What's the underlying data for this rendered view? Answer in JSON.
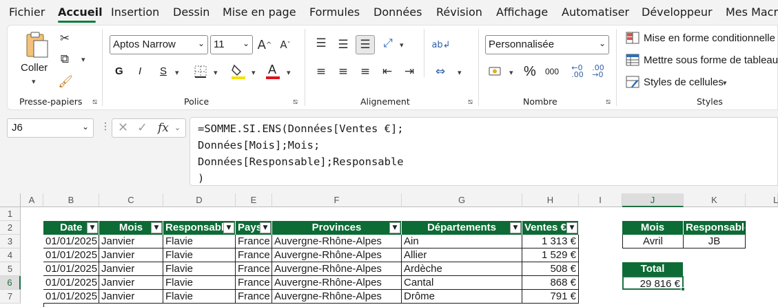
{
  "tabs": [
    "Fichier",
    "Accueil",
    "Insertion",
    "Dessin",
    "Mise en page",
    "Formules",
    "Données",
    "Révision",
    "Affichage",
    "Automatiser",
    "Développeur",
    "Mes Macro"
  ],
  "ribbon": {
    "clipboard": {
      "paste_label": "Coller",
      "group_label": "Presse-papiers"
    },
    "font": {
      "name": "Aptos Narrow",
      "size": "11",
      "bold": "G",
      "italic": "I",
      "underline": "S",
      "group_label": "Police"
    },
    "alignment": {
      "group_label": "Alignement"
    },
    "number": {
      "format": "Personnalisée",
      "percent": "%",
      "thousands": "000",
      "group_label": "Nombre"
    },
    "styles": {
      "conditional": "Mise en forme conditionnelle",
      "table": "Mettre sous forme de tableau",
      "cell_styles": "Styles de cellules",
      "group_label": "Styles"
    }
  },
  "formula_bar": {
    "name_box": "J6",
    "fx": "fx",
    "formula": "=SOMME.SI.ENS(Données[Ventes €];\nDonnées[Mois];Mois;\nDonnées[Responsable];Responsable\n)"
  },
  "columns": [
    "A",
    "B",
    "C",
    "D",
    "E",
    "F",
    "G",
    "H",
    "I",
    "J",
    "K",
    "L"
  ],
  "rows": [
    "1",
    "2",
    "3",
    "4",
    "5",
    "6",
    "7"
  ],
  "table": {
    "headers": [
      "Date",
      "Mois",
      "Responsable",
      "Pays",
      "Provinces",
      "Départements",
      "Ventes €"
    ],
    "rows": [
      [
        "01/01/2025",
        "Janvier",
        "Flavie",
        "France",
        "Auvergne-Rhône-Alpes",
        "Ain",
        "1 313 €"
      ],
      [
        "01/01/2025",
        "Janvier",
        "Flavie",
        "France",
        "Auvergne-Rhône-Alpes",
        "Allier",
        "1 529 €"
      ],
      [
        "01/01/2025",
        "Janvier",
        "Flavie",
        "France",
        "Auvergne-Rhône-Alpes",
        "Ardèche",
        "508 €"
      ],
      [
        "01/01/2025",
        "Janvier",
        "Flavie",
        "France",
        "Auvergne-Rhône-Alpes",
        "Cantal",
        "868 €"
      ],
      [
        "01/01/2025",
        "Janvier",
        "Flavie",
        "France",
        "Auvergne-Rhône-Alpes",
        "Drôme",
        "791 €"
      ]
    ]
  },
  "criteria": {
    "mois_header": "Mois",
    "resp_header": "Responsable",
    "mois_value": "Avril",
    "resp_value": "JB"
  },
  "total": {
    "header": "Total",
    "value": "29 816 €"
  },
  "colors": {
    "accent": "#0f7b3f",
    "table_header": "#0d6b35"
  }
}
